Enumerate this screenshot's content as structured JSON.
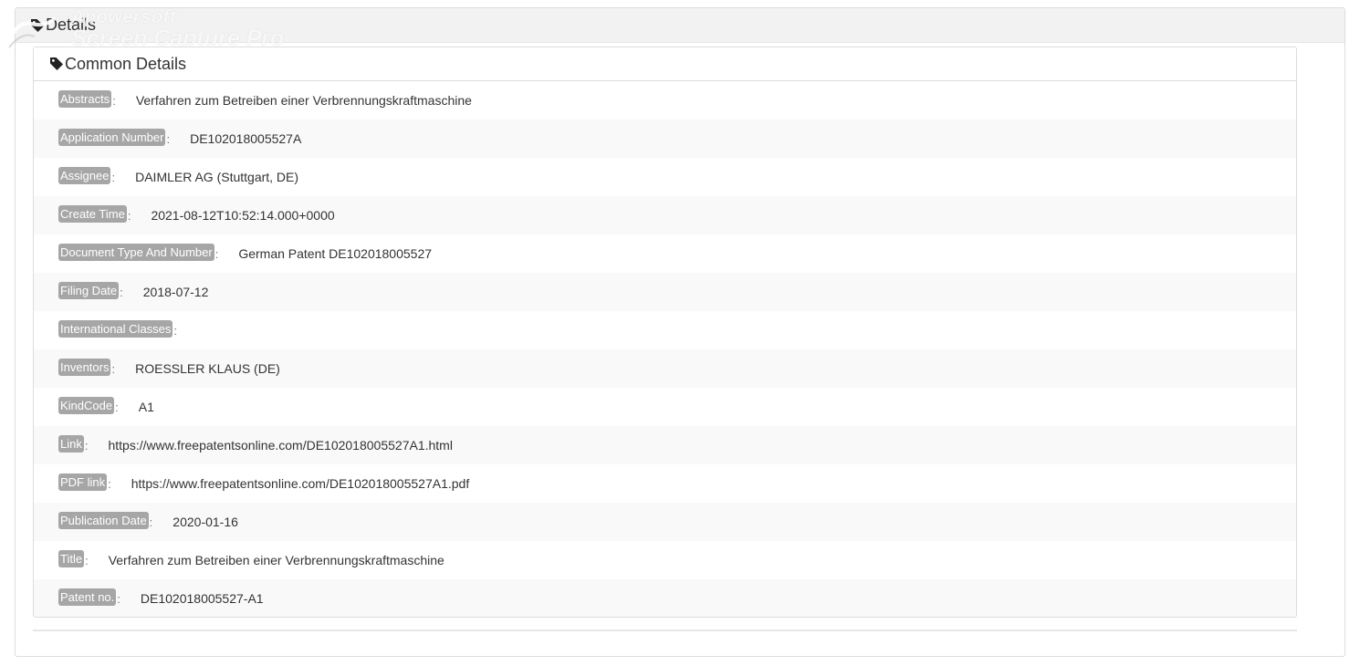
{
  "outer": {
    "title": "Details"
  },
  "watermark": {
    "line1": "Apowersoft",
    "line2": "Screen Capture Pro"
  },
  "inner": {
    "title": "Common Details"
  },
  "rows": [
    {
      "label": "Abstracts",
      "value": "Verfahren zum Betreiben einer Verbrennungskraftmaschine"
    },
    {
      "label": "Application Number",
      "value": "DE102018005527A"
    },
    {
      "label": "Assignee",
      "value": "DAIMLER AG (Stuttgart, DE)"
    },
    {
      "label": "Create Time",
      "value": "2021-08-12T10:52:14.000+0000"
    },
    {
      "label": "Document Type And Number",
      "value": "German Patent DE102018005527"
    },
    {
      "label": "Filing Date",
      "value": "2018-07-12"
    },
    {
      "label": "International Classes",
      "value": ""
    },
    {
      "label": "Inventors",
      "value": "ROESSLER KLAUS (DE)"
    },
    {
      "label": "KindCode",
      "value": "A1"
    },
    {
      "label": "Link",
      "value": "https://www.freepatentsonline.com/DE102018005527A1.html"
    },
    {
      "label": "PDF link",
      "value": "https://www.freepatentsonline.com/DE102018005527A1.pdf"
    },
    {
      "label": "Publication Date",
      "value": "2020-01-16"
    },
    {
      "label": "Title",
      "value": "Verfahren zum Betreiben einer Verbrennungskraftmaschine"
    },
    {
      "label": "Patent no.",
      "value": "DE102018005527-A1"
    }
  ],
  "colors": {
    "badge": "#a6a6a6",
    "stripe": "#f9f9f9",
    "heading_bg": "#f2f2f2"
  }
}
